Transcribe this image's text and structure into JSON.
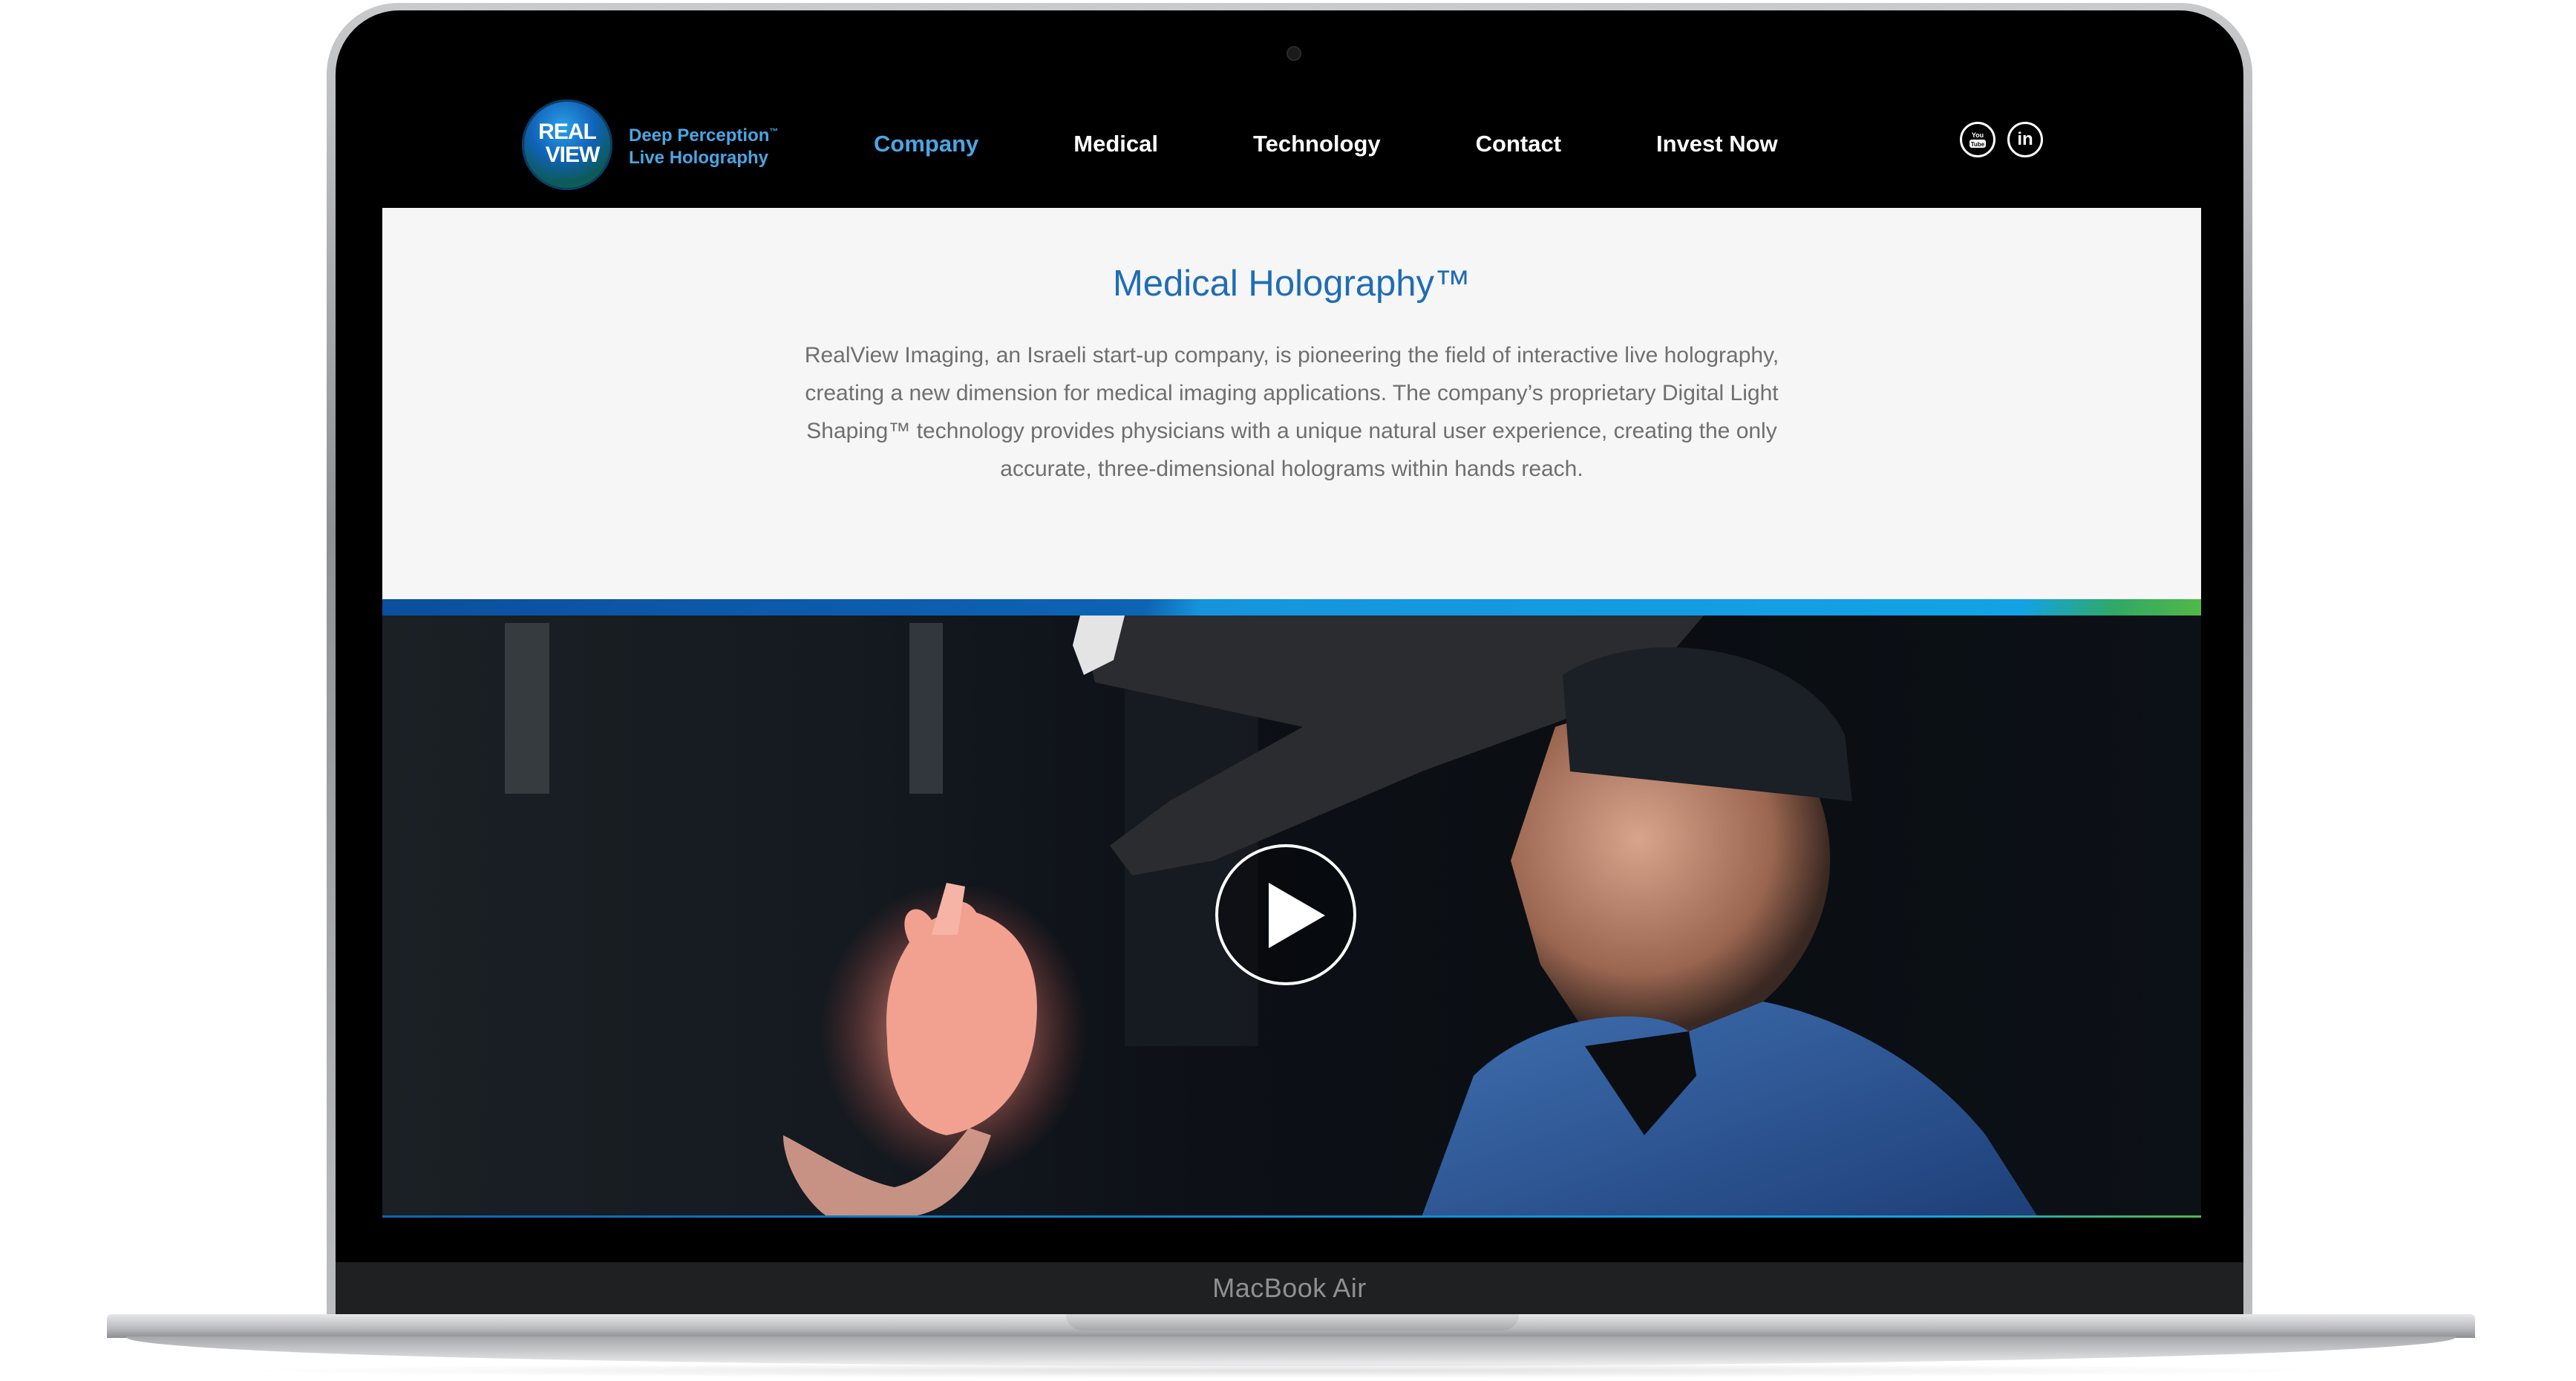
{
  "brand": {
    "logo_line1": "REAL",
    "logo_line2": "VIEW",
    "tagline_line1": "Deep Perception",
    "tagline_tm": "™",
    "tagline_line2": "Live Holography"
  },
  "nav": {
    "items": [
      {
        "label": "Company",
        "active": true
      },
      {
        "label": "Medical",
        "active": false
      },
      {
        "label": "Technology",
        "active": false
      },
      {
        "label": "Contact",
        "active": false
      },
      {
        "label": "Invest Now",
        "active": false
      }
    ]
  },
  "social": {
    "youtube_label": "You Tube",
    "linkedin_label": "in"
  },
  "hero": {
    "title": "Medical Holography™",
    "body": "RealView Imaging, an Israeli start-up company, is pioneering the field of interactive live holography, creating a new dimension for medical imaging applications. The company’s proprietary Digital Light Shaping™ technology provides physicians with a unique natural user experience, creating the only accurate, three-dimensional holograms within hands reach."
  },
  "video": {
    "play_icon": "play-icon"
  },
  "device": {
    "label": "MacBook Air"
  },
  "colors": {
    "accent_blue": "#1e6db5",
    "nav_active": "#4aa6e4",
    "band_green": "#52b947"
  }
}
